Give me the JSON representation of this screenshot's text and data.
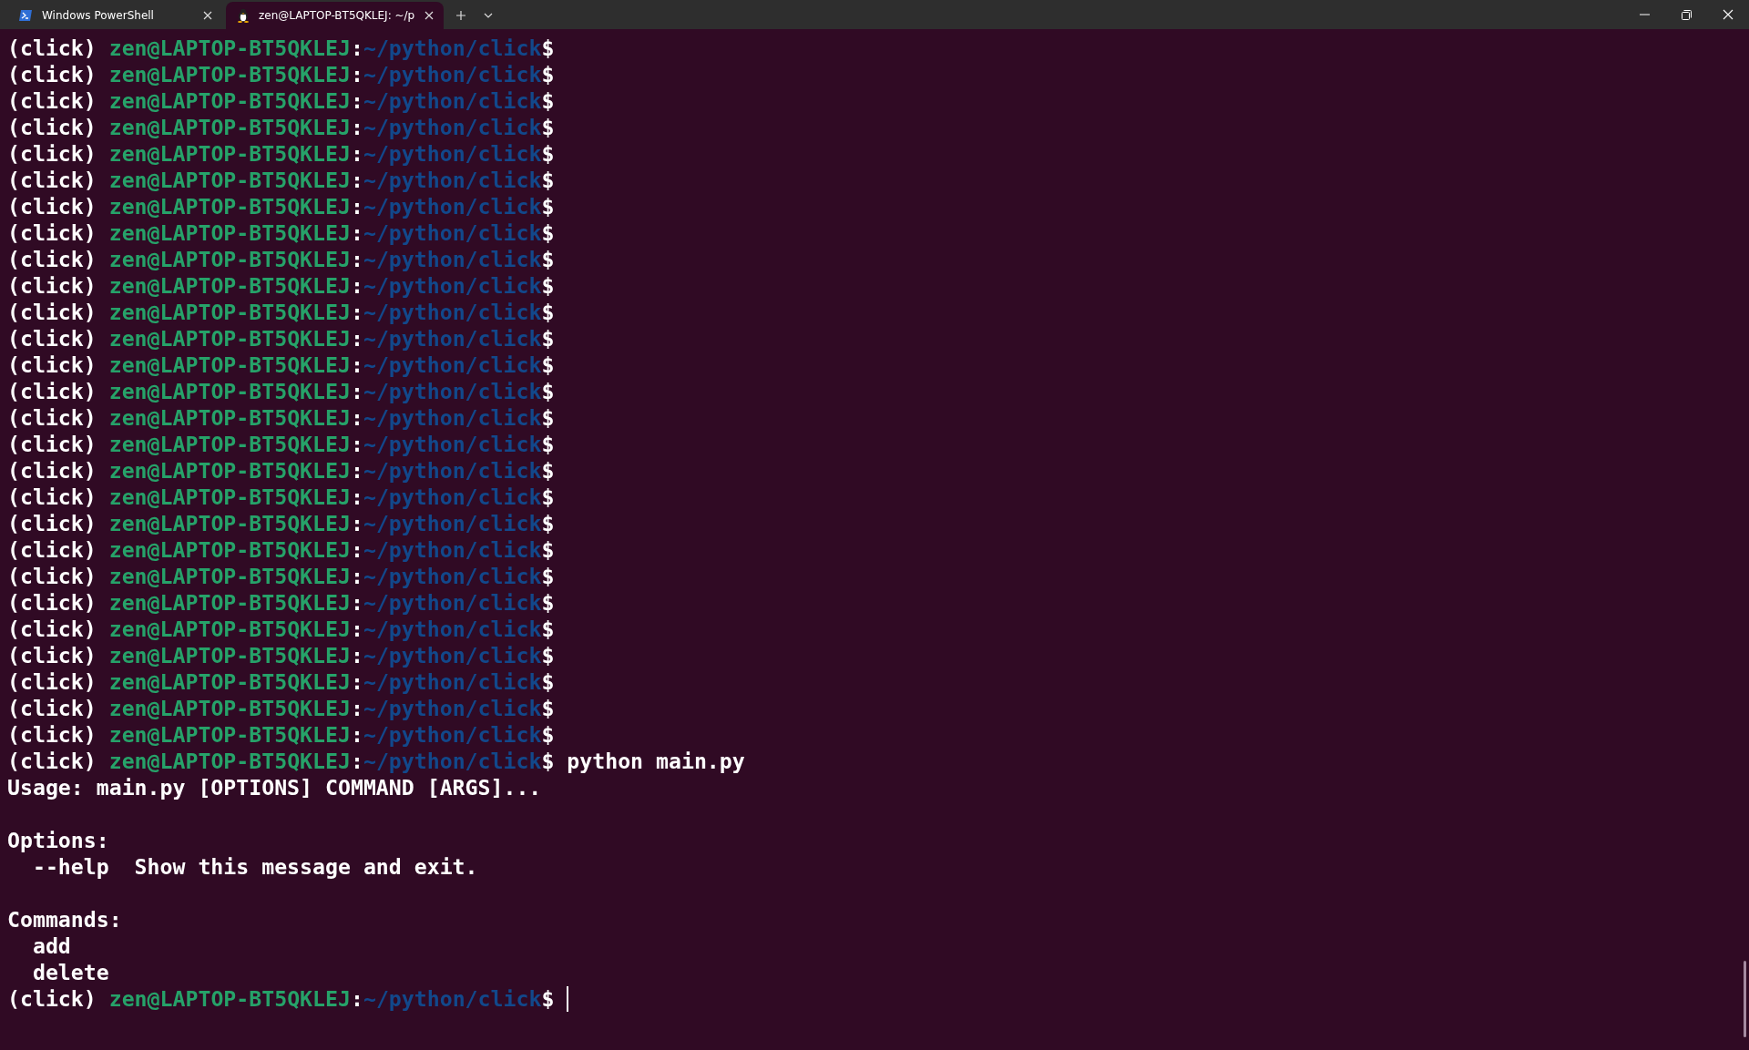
{
  "tabs": [
    {
      "title": "Windows PowerShell",
      "kind": "powershell",
      "selected": false
    },
    {
      "title": "zen@LAPTOP-BT5QKLEJ: ~/p",
      "kind": "linux",
      "selected": true
    }
  ],
  "terminal": {
    "lines": [
      {
        "kind": "prompt",
        "env": "(click)",
        "user_host": "zen@LAPTOP-BT5QKLEJ",
        "sep": ":",
        "path": "~/python/click",
        "symbol": "$"
      },
      {
        "kind": "prompt",
        "env": "(click)",
        "user_host": "zen@LAPTOP-BT5QKLEJ",
        "sep": ":",
        "path": "~/python/click",
        "symbol": "$"
      },
      {
        "kind": "prompt",
        "env": "(click)",
        "user_host": "zen@LAPTOP-BT5QKLEJ",
        "sep": ":",
        "path": "~/python/click",
        "symbol": "$"
      },
      {
        "kind": "prompt",
        "env": "(click)",
        "user_host": "zen@LAPTOP-BT5QKLEJ",
        "sep": ":",
        "path": "~/python/click",
        "symbol": "$"
      },
      {
        "kind": "prompt",
        "env": "(click)",
        "user_host": "zen@LAPTOP-BT5QKLEJ",
        "sep": ":",
        "path": "~/python/click",
        "symbol": "$"
      },
      {
        "kind": "prompt",
        "env": "(click)",
        "user_host": "zen@LAPTOP-BT5QKLEJ",
        "sep": ":",
        "path": "~/python/click",
        "symbol": "$"
      },
      {
        "kind": "prompt",
        "env": "(click)",
        "user_host": "zen@LAPTOP-BT5QKLEJ",
        "sep": ":",
        "path": "~/python/click",
        "symbol": "$"
      },
      {
        "kind": "prompt",
        "env": "(click)",
        "user_host": "zen@LAPTOP-BT5QKLEJ",
        "sep": ":",
        "path": "~/python/click",
        "symbol": "$"
      },
      {
        "kind": "prompt",
        "env": "(click)",
        "user_host": "zen@LAPTOP-BT5QKLEJ",
        "sep": ":",
        "path": "~/python/click",
        "symbol": "$"
      },
      {
        "kind": "prompt",
        "env": "(click)",
        "user_host": "zen@LAPTOP-BT5QKLEJ",
        "sep": ":",
        "path": "~/python/click",
        "symbol": "$"
      },
      {
        "kind": "prompt",
        "env": "(click)",
        "user_host": "zen@LAPTOP-BT5QKLEJ",
        "sep": ":",
        "path": "~/python/click",
        "symbol": "$"
      },
      {
        "kind": "prompt",
        "env": "(click)",
        "user_host": "zen@LAPTOP-BT5QKLEJ",
        "sep": ":",
        "path": "~/python/click",
        "symbol": "$"
      },
      {
        "kind": "prompt",
        "env": "(click)",
        "user_host": "zen@LAPTOP-BT5QKLEJ",
        "sep": ":",
        "path": "~/python/click",
        "symbol": "$"
      },
      {
        "kind": "prompt",
        "env": "(click)",
        "user_host": "zen@LAPTOP-BT5QKLEJ",
        "sep": ":",
        "path": "~/python/click",
        "symbol": "$"
      },
      {
        "kind": "prompt",
        "env": "(click)",
        "user_host": "zen@LAPTOP-BT5QKLEJ",
        "sep": ":",
        "path": "~/python/click",
        "symbol": "$"
      },
      {
        "kind": "prompt",
        "env": "(click)",
        "user_host": "zen@LAPTOP-BT5QKLEJ",
        "sep": ":",
        "path": "~/python/click",
        "symbol": "$"
      },
      {
        "kind": "prompt",
        "env": "(click)",
        "user_host": "zen@LAPTOP-BT5QKLEJ",
        "sep": ":",
        "path": "~/python/click",
        "symbol": "$"
      },
      {
        "kind": "prompt",
        "env": "(click)",
        "user_host": "zen@LAPTOP-BT5QKLEJ",
        "sep": ":",
        "path": "~/python/click",
        "symbol": "$"
      },
      {
        "kind": "prompt",
        "env": "(click)",
        "user_host": "zen@LAPTOP-BT5QKLEJ",
        "sep": ":",
        "path": "~/python/click",
        "symbol": "$"
      },
      {
        "kind": "prompt",
        "env": "(click)",
        "user_host": "zen@LAPTOP-BT5QKLEJ",
        "sep": ":",
        "path": "~/python/click",
        "symbol": "$"
      },
      {
        "kind": "prompt",
        "env": "(click)",
        "user_host": "zen@LAPTOP-BT5QKLEJ",
        "sep": ":",
        "path": "~/python/click",
        "symbol": "$"
      },
      {
        "kind": "prompt",
        "env": "(click)",
        "user_host": "zen@LAPTOP-BT5QKLEJ",
        "sep": ":",
        "path": "~/python/click",
        "symbol": "$"
      },
      {
        "kind": "prompt",
        "env": "(click)",
        "user_host": "zen@LAPTOP-BT5QKLEJ",
        "sep": ":",
        "path": "~/python/click",
        "symbol": "$"
      },
      {
        "kind": "prompt",
        "env": "(click)",
        "user_host": "zen@LAPTOP-BT5QKLEJ",
        "sep": ":",
        "path": "~/python/click",
        "symbol": "$"
      },
      {
        "kind": "prompt",
        "env": "(click)",
        "user_host": "zen@LAPTOP-BT5QKLEJ",
        "sep": ":",
        "path": "~/python/click",
        "symbol": "$"
      },
      {
        "kind": "prompt",
        "env": "(click)",
        "user_host": "zen@LAPTOP-BT5QKLEJ",
        "sep": ":",
        "path": "~/python/click",
        "symbol": "$"
      },
      {
        "kind": "prompt",
        "env": "(click)",
        "user_host": "zen@LAPTOP-BT5QKLEJ",
        "sep": ":",
        "path": "~/python/click",
        "symbol": "$"
      },
      {
        "kind": "prompt",
        "env": "(click)",
        "user_host": "zen@LAPTOP-BT5QKLEJ",
        "sep": ":",
        "path": "~/python/click",
        "symbol": "$",
        "command": "python main.py"
      },
      {
        "kind": "output",
        "text": "Usage: main.py [OPTIONS] COMMAND [ARGS]..."
      },
      {
        "kind": "blank"
      },
      {
        "kind": "output",
        "text": "Options:"
      },
      {
        "kind": "output",
        "text": "  --help  Show this message and exit."
      },
      {
        "kind": "blank"
      },
      {
        "kind": "output",
        "text": "Commands:"
      },
      {
        "kind": "output",
        "text": "  add"
      },
      {
        "kind": "output",
        "text": "  delete"
      },
      {
        "kind": "prompt",
        "env": "(click)",
        "user_host": "zen@LAPTOP-BT5QKLEJ",
        "sep": ":",
        "path": "~/python/click",
        "symbol": "$",
        "cursor": true
      }
    ]
  }
}
